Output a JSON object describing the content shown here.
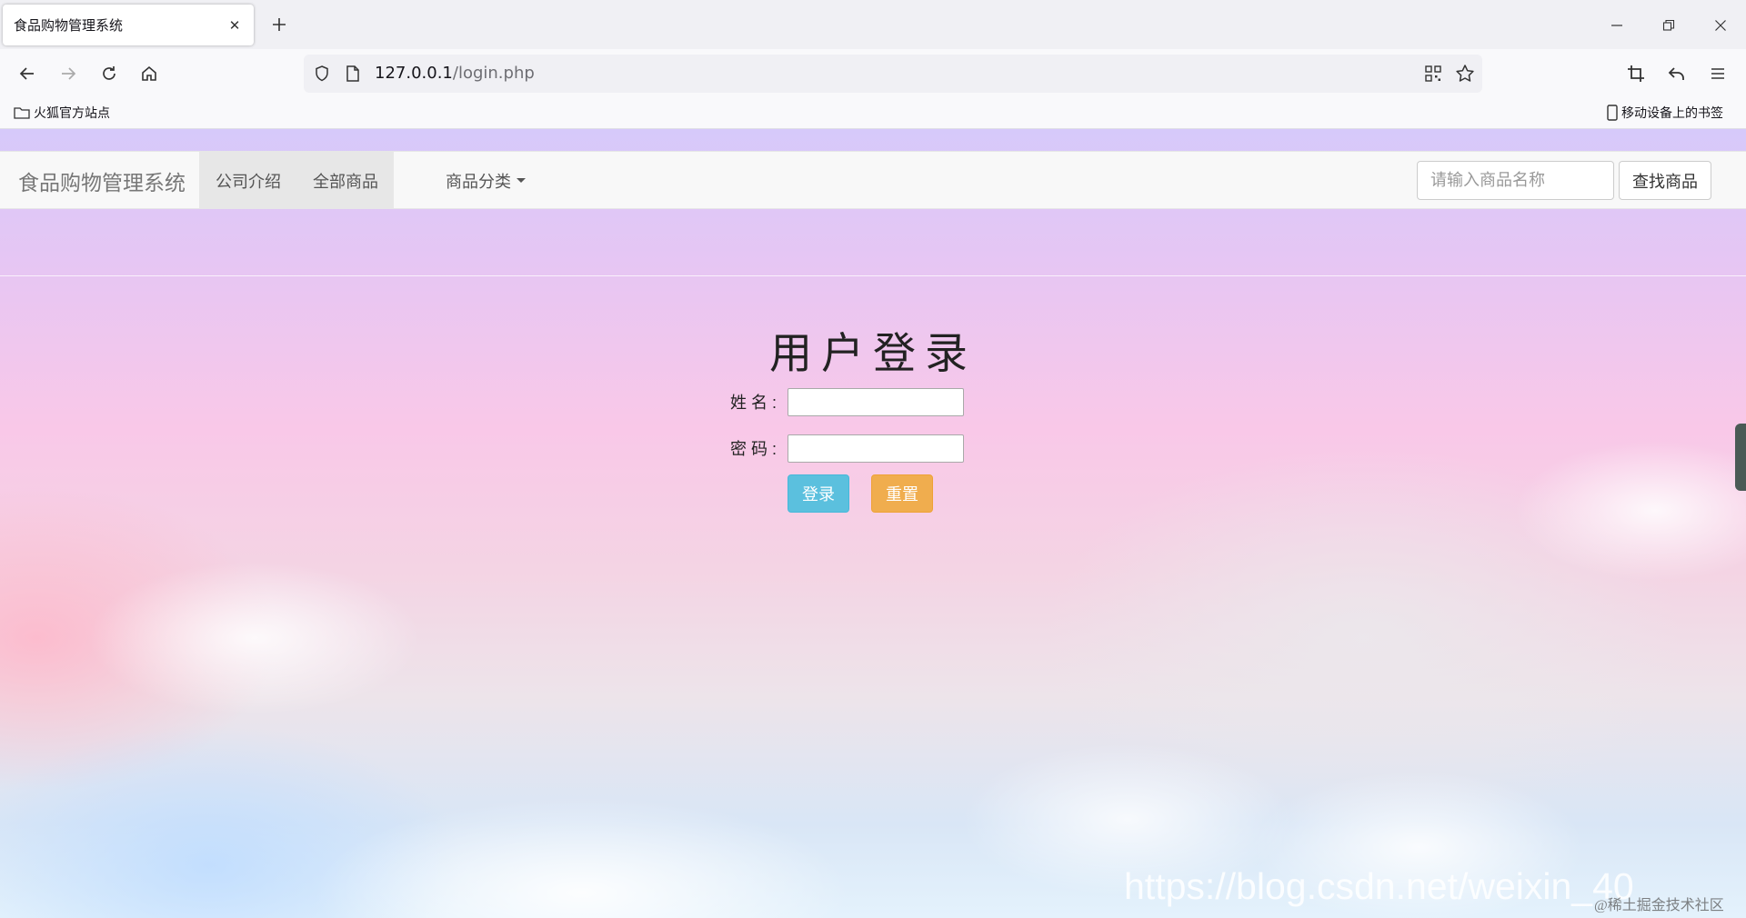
{
  "browser": {
    "tab_title": "食品购物管理系统",
    "url_host": "127.0.0.1",
    "url_path": "/login.php",
    "bookmarks_left": "火狐官方站点",
    "bookmarks_right": "移动设备上的书签"
  },
  "site": {
    "brand": "食品购物管理系统",
    "nav": [
      "公司介绍",
      "全部商品",
      "商品分类"
    ],
    "search_placeholder": "请输入商品名称",
    "search_button": "查找商品"
  },
  "login": {
    "title": "用户登录",
    "username_label": "姓名:",
    "password_label": "密码:",
    "username_value": "",
    "password_value": "",
    "login_button": "登录",
    "reset_button": "重置"
  },
  "watermark": {
    "url": "https://blog.csdn.net/weixin_40",
    "community": "@稀土掘金技术社区"
  },
  "colors": {
    "login_button": "#5bc0de",
    "reset_button": "#f0ad4e"
  }
}
